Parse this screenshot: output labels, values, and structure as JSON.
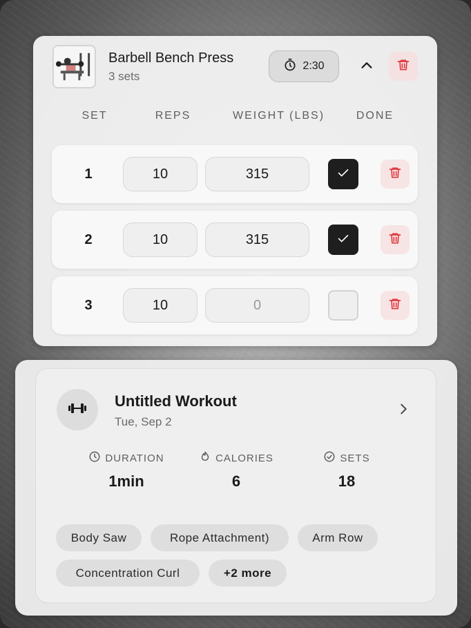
{
  "exercise": {
    "title": "Barbell Bench Press",
    "subtitle": "3 sets",
    "timer": "2:30",
    "columns": [
      "SET",
      "REPS",
      "WEIGHT (LBS)",
      "DONE"
    ],
    "sets": [
      {
        "num": "1",
        "reps": "10",
        "weight": "315",
        "done": true
      },
      {
        "num": "2",
        "reps": "10",
        "weight": "315",
        "done": true
      },
      {
        "num": "3",
        "reps": "10",
        "weight": "0",
        "done": false
      }
    ],
    "delete_color": "#e0383e"
  },
  "workout": {
    "title": "Untitled Workout",
    "date": "Tue, Sep 2",
    "stats": [
      {
        "label": "DURATION",
        "value": "1min",
        "icon": "clock-icon"
      },
      {
        "label": "CALORIES",
        "value": "6",
        "icon": "flame-icon"
      },
      {
        "label": "SETS",
        "value": "18",
        "icon": "check-circle-icon"
      }
    ],
    "tags": [
      "Body Saw",
      "Rope Attachment)",
      "Arm Row",
      "Concentration Curl",
      "+2 more"
    ]
  }
}
